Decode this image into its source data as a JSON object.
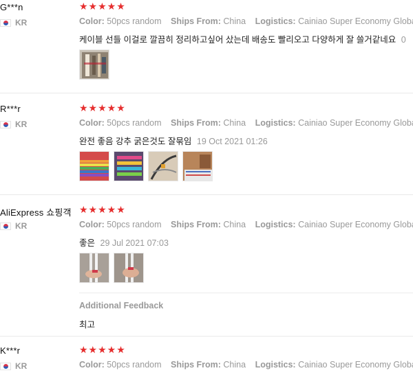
{
  "labels": {
    "color": "Color:",
    "ships_from": "Ships From:",
    "logistics": "Logistics:"
  },
  "reviews": [
    {
      "user": "G***n",
      "country": "KR",
      "stars": "★★★★★",
      "color": "50pcs random",
      "ships_from": "China",
      "logistics": "Cainiao Super Economy Global",
      "text": "케이블 선들 이걸로 깔끔히 정리하고싶어 샀는데 배송도 빨리오고 다양하게 잘 쓸거같네요",
      "date": "0",
      "thumbs": [
        "photo-cables-shelf"
      ]
    },
    {
      "user": "R***r",
      "country": "KR",
      "stars": "★★★★★",
      "color": "50pcs random",
      "ships_from": "China",
      "logistics": "Cainiao Super Economy Global",
      "text": "완전 좋음 강추 굵은것도 잘묶임",
      "date": "19 Oct 2021 01:26",
      "thumbs": [
        "photo-rainbow-ties",
        "photo-colored-ties",
        "photo-tied-cables",
        "photo-box-cables"
      ]
    },
    {
      "user": "AliExpress 쇼핑객",
      "country": "KR",
      "stars": "★★★★★",
      "color": "50pcs random",
      "ships_from": "China",
      "logistics": "Cainiao Super Economy Global",
      "text": "좋은",
      "date": "29 Jul 2021 07:03",
      "thumbs": [
        "photo-hand-cable-1",
        "photo-hand-cable-2"
      ],
      "feedback_title": "Additional Feedback",
      "feedback_text": "최고"
    },
    {
      "user": "K***r",
      "country": "KR",
      "stars": "★★★★★",
      "color": "50pcs random",
      "ships_from": "China",
      "logistics": "Cainiao Super Economy Global"
    }
  ],
  "colors": {
    "star": "#e62e2e",
    "muted": "#999999",
    "text": "#222222"
  }
}
